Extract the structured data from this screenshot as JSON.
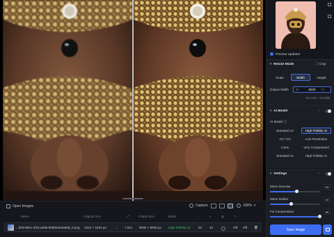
{
  "toolbar": {
    "open_images": "Open Images",
    "capture": "Capture",
    "zoom": "100%"
  },
  "table": {
    "headers": {
      "name": "Name",
      "original_size": "Original Size",
      "output_size": "Output Size",
      "model": "Model"
    },
    "row": {
      "name": "...b0d-89ec-4f16-add5-b89bb454a9d5_0.png",
      "original_size": "1024 × 1024 px",
      "scale": "7.81x",
      "output_size": "8000 × 8000 px",
      "model": "High Fidelity v2",
      "value1": "53",
      "value2": "42",
      "off1": "Off",
      "off2": "Off"
    }
  },
  "panel": {
    "preview_status": "Preview Updated",
    "resize": {
      "title": "Resize Mode",
      "crop": "Crop",
      "options": [
        "Scale",
        "Width",
        "Height"
      ],
      "active": "Width",
      "output_label": "Output Width",
      "input_prefix": "W",
      "input_value": "8000",
      "unit": "PX",
      "file_size": "File Size: ~44.5MB"
    },
    "ai_model": {
      "title": "AI Model",
      "label": "AI Model",
      "models": [
        "Standard v2",
        "High Fidelity v2",
        "Art / CG",
        "Low Resolution",
        "Lines",
        "Very Compressed",
        "Standard v1",
        "High Fidelity v1"
      ],
      "active": "High Fidelity v2"
    },
    "settings": {
      "title": "Settings",
      "sliders": [
        {
          "label": "Minor Denoise",
          "value": "53",
          "fraction": 0.53
        },
        {
          "label": "Minor Deblur",
          "value": "42",
          "fraction": 0.42
        },
        {
          "label": "Fix Compression",
          "value": "99",
          "fraction": 0.99
        }
      ]
    },
    "save": "Save Image"
  },
  "colors": {
    "accent": "#3d6df2",
    "model_green": "#42c46b"
  }
}
